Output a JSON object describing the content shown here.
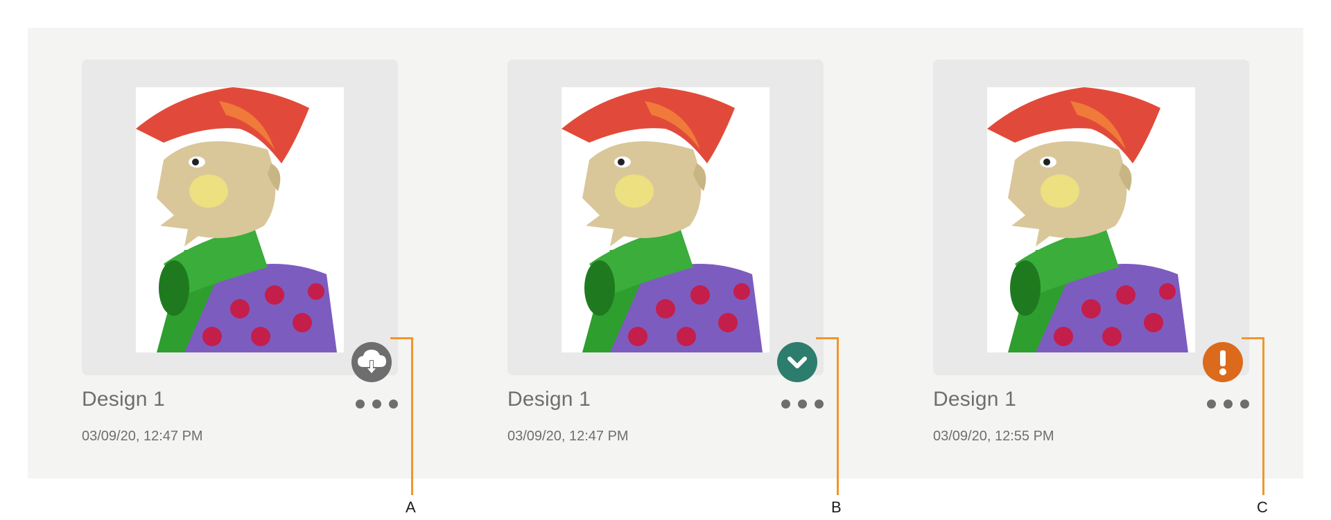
{
  "cards": [
    {
      "title": "Design 1",
      "date": "03/09/20, 12:47 PM",
      "status": "cloud-download",
      "badge_color": "#6e6e6e",
      "callout": "A"
    },
    {
      "title": "Design 1",
      "date": "03/09/20, 12:47 PM",
      "status": "synced-check",
      "badge_color": "#2d7d6e",
      "callout": "B"
    },
    {
      "title": "Design 1",
      "date": "03/09/20, 12:55 PM",
      "status": "sync-error",
      "badge_color": "#dc6a1c",
      "callout": "C"
    }
  ],
  "colors": {
    "callout_line": "#f0962a",
    "panel_bg": "#f4f4f3",
    "thumb_frame": "#e9e9e9"
  }
}
